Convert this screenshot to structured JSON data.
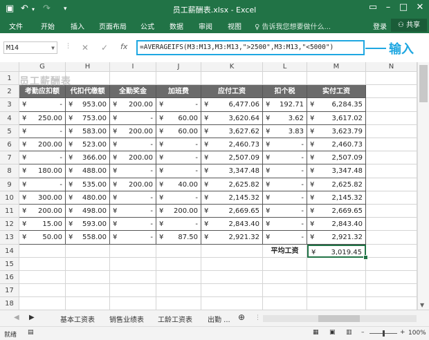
{
  "title_bar": {
    "title": "员工薪酬表.xlsx - Excel",
    "save_icon": "save-icon",
    "undo_icon": "undo-icon",
    "redo_icon": "redo-icon"
  },
  "ribbon": {
    "tabs": [
      "文件",
      "开始",
      "插入",
      "页面布局",
      "公式",
      "数据",
      "审阅",
      "视图"
    ],
    "tell_me": "告诉我您想要做什么...",
    "login": "登录",
    "share": "共享"
  },
  "formula_bar": {
    "name_box": "M14",
    "fx_label": "fx",
    "formula": "=AVERAGEIFS(M3:M13,M3:M13,\">2500\",M3:M13,\"<5000\")",
    "annotation": "输入"
  },
  "sheet": {
    "columns": [
      "G",
      "H",
      "I",
      "J",
      "K",
      "L",
      "M",
      "N"
    ],
    "rows": [
      "1",
      "2",
      "3",
      "4",
      "5",
      "6",
      "7",
      "8",
      "9",
      "10",
      "11",
      "12",
      "13",
      "14",
      "15",
      "16",
      "17",
      "18"
    ],
    "title_text": "员工薪酬表",
    "headers": [
      "考勤应扣额",
      "代扣代缴额",
      "全勤奖金",
      "加班费",
      "应付工资",
      "扣个税",
      "实付工资"
    ],
    "data": [
      [
        "-",
        "953.00",
        "200.00",
        "-",
        "6,477.06",
        "192.71",
        "6,284.35"
      ],
      [
        "250.00",
        "753.00",
        "-",
        "60.00",
        "3,620.64",
        "3.62",
        "3,617.02"
      ],
      [
        "-",
        "583.00",
        "200.00",
        "60.00",
        "3,627.62",
        "3.83",
        "3,623.79"
      ],
      [
        "200.00",
        "523.00",
        "-",
        "-",
        "2,460.73",
        "-",
        "2,460.73"
      ],
      [
        "-",
        "366.00",
        "200.00",
        "-",
        "2,507.09",
        "-",
        "2,507.09"
      ],
      [
        "180.00",
        "488.00",
        "-",
        "-",
        "3,347.48",
        "-",
        "3,347.48"
      ],
      [
        "-",
        "535.00",
        "200.00",
        "40.00",
        "2,625.82",
        "-",
        "2,625.82"
      ],
      [
        "300.00",
        "480.00",
        "-",
        "-",
        "2,145.32",
        "-",
        "2,145.32"
      ],
      [
        "200.00",
        "498.00",
        "-",
        "200.00",
        "2,669.65",
        "-",
        "2,669.65"
      ],
      [
        "15.00",
        "593.00",
        "-",
        "-",
        "2,843.40",
        "-",
        "2,843.40"
      ],
      [
        "50.00",
        "558.00",
        "-",
        "87.50",
        "2,921.32",
        "-",
        "2,921.32"
      ]
    ],
    "avg_label": "平均工资",
    "avg_value": "3,019.45",
    "currency": "¥"
  },
  "sheet_tabs": [
    "基本工资表",
    "销售业绩表",
    "工龄工资表",
    "出勤 ..."
  ],
  "status": {
    "ready": "就绪",
    "zoom": "100%"
  }
}
